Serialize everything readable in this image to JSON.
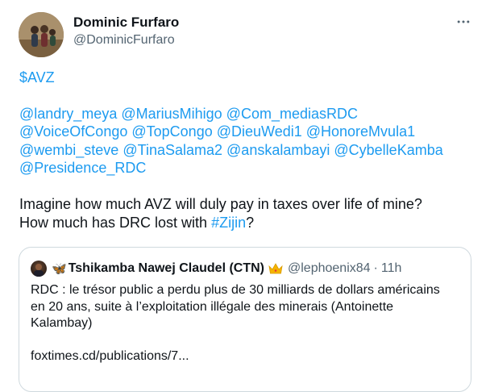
{
  "author": {
    "name": "Dominic Furfaro",
    "handle": "@DominicFurfaro"
  },
  "icons": {
    "more": "more-horizontal-icon",
    "quote_prefix": "butterfly-icon",
    "quote_badge": "crown-icon"
  },
  "colors": {
    "link": "#1d9bf0",
    "text": "#0f1419",
    "secondary": "#536471",
    "border": "#cfd9de"
  },
  "tweet": {
    "cashtag": "$AVZ",
    "mentions": [
      [
        "@landry_meya",
        "@MariusMihigo",
        "@Com_mediasRDC"
      ],
      [
        "@VoiceOfCongo",
        "@TopCongo",
        "@DieuWedi1",
        "@HonoreMvula1"
      ],
      [
        "@wembi_steve",
        "@TinaSalama2",
        "@anskalambayi",
        "@CybelleKamba"
      ],
      [
        "@Presidence_RDC"
      ]
    ],
    "text_line1": "Imagine how much AVZ will duly pay in taxes over life of mine?",
    "text_line2_before": "How much has DRC lost with ",
    "hashtag": "#Zijin",
    "text_line2_after": "?"
  },
  "quote": {
    "emoji_prefix": "🦋",
    "name": "Tshikamba Nawej Claudel (CTN)",
    "handle": "@lephoenix84",
    "separator": "·",
    "time": "11h",
    "text": "RDC : le trésor public a perdu plus de 30 milliards de dollars américains en 20 ans, suite à l’exploitation illégale des minerais (Antoinette Kalambay)",
    "link": "foxtimes.cd/publications/7..."
  }
}
